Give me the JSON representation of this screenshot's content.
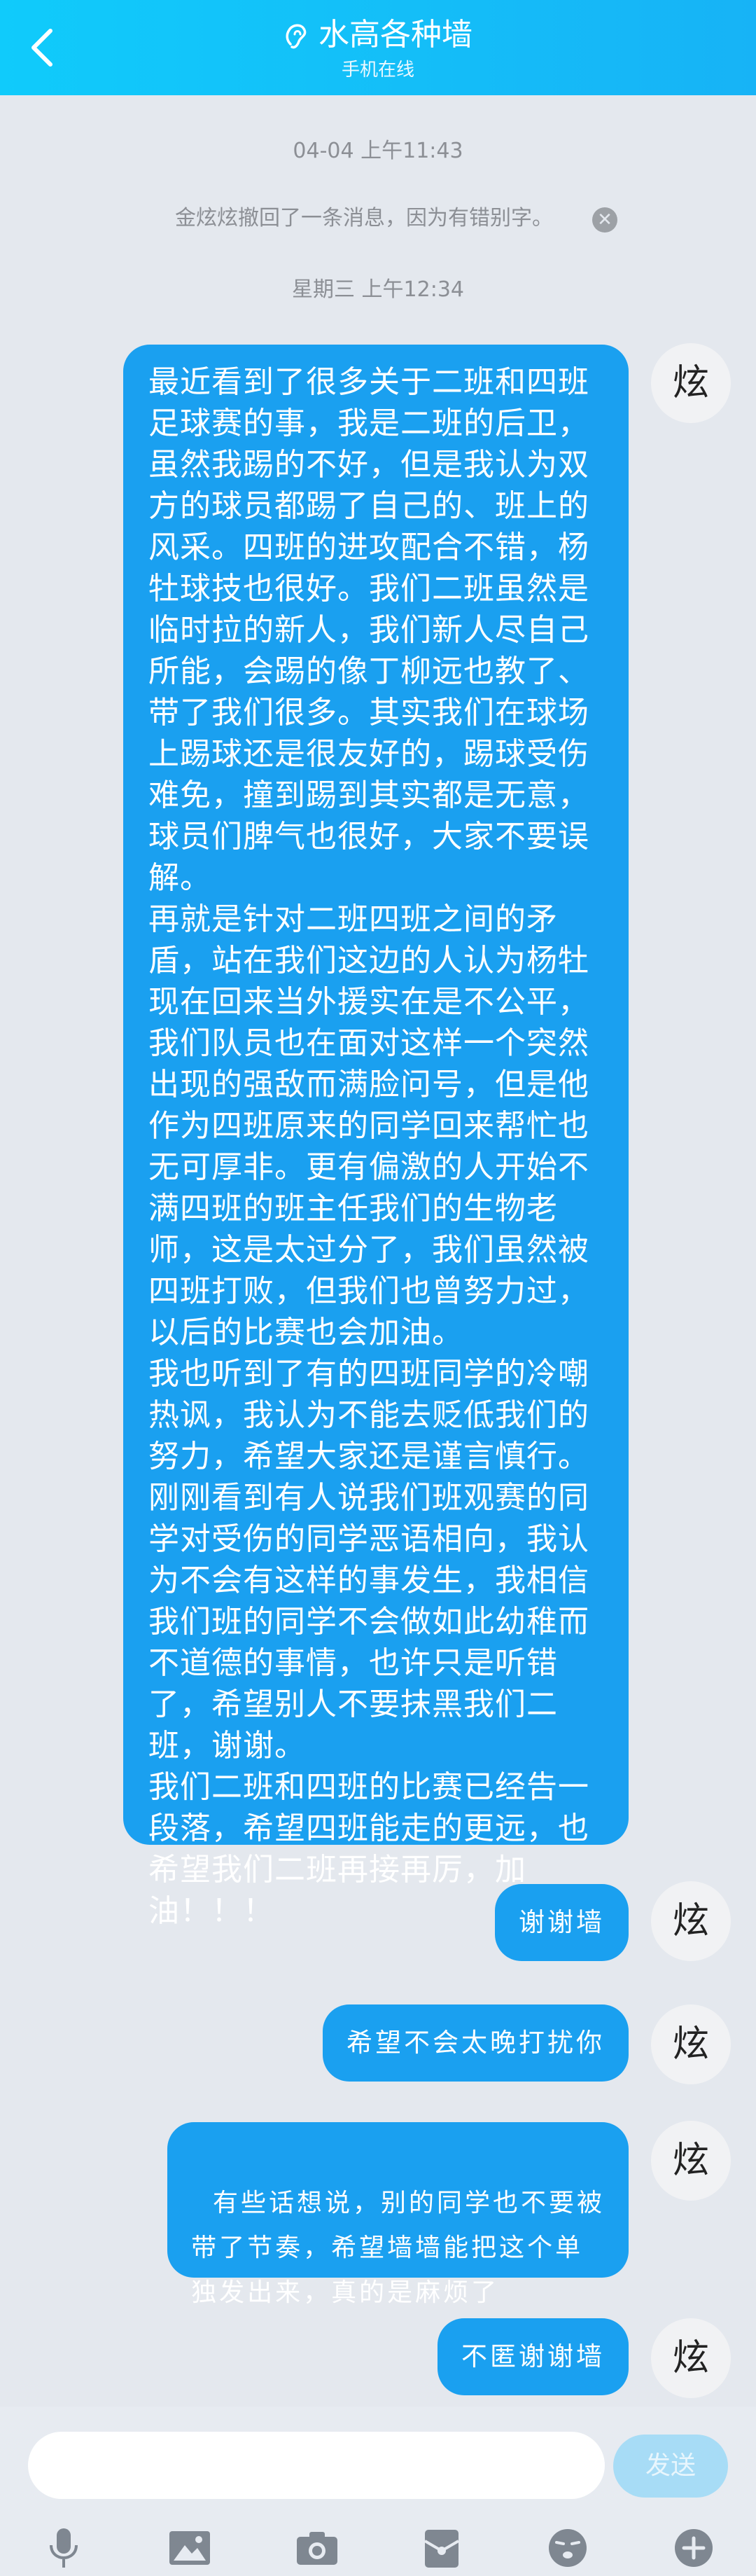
{
  "header": {
    "title": "水高各种墙",
    "subtitle": "手机在线",
    "color_start": "#10cbfb",
    "color_end": "#17b3f6"
  },
  "messages": {
    "timestamp_1": "04-04 上午11:43",
    "recall_notice": "金炫炫撤回了一条消息，因为有错别字。",
    "timestamp_2": "星期三 上午12:34",
    "avatar_char": "炫",
    "long_message": "最近看到了很多关于二班和四班足球赛的事，我是二班的后卫，虽然我踢的不好，但是我认为双方的球员都踢了自己的、班上的风采。四班的进攻配合不错，杨牡球技也很好。我们二班虽然是临时拉的新人，我们新人尽自己所能，会踢的像丁柳远也教了、带了我们很多。其实我们在球场上踢球还是很友好的，踢球受伤难免，撞到踢到其实都是无意，球员们脾气也很好，大家不要误解。\n再就是针对二班四班之间的矛盾，站在我们这边的人认为杨牡现在回来当外援实在是不公平，我们队员也在面对这样一个突然出现的强敌而满脸问号，但是他作为四班原来的同学回来帮忙也无可厚非。更有偏激的人开始不满四班的班主任我们的生物老师，这是太过分了，我们虽然被四班打败，但我们也曾努力过，以后的比赛也会加油。\n我也听到了有的四班同学的冷嘲热讽，我认为不能去贬低我们的努力，希望大家还是谨言慎行。刚刚看到有人说我们班观赛的同学对受伤的同学恶语相向，我认为不会有这样的事发生，我相信我们班的同学不会做如此幼稚而不道德的事情，也许只是听错了，希望别人不要抹黑我们二班，谢谢。\n我们二班和四班的比赛已经告一段落，希望四班能走的更远，也希望我们二班再接再厉，加油！！！",
    "msg_thanks": "谢谢墙",
    "msg_late": "希望不会太晚打扰你",
    "msg_request": "有些话想说，别的同学也不要被\n带了节奏，希望墙墙能把这个单\n独发出来，真的是麻烦了",
    "msg_thanks_2": "不匿谢谢墙",
    "bubble_color": "#1aa0f0"
  },
  "composer": {
    "input_value": "",
    "input_placeholder": "",
    "send_label": "发送"
  },
  "toolbar": {
    "icons": [
      "microphone-icon",
      "image-icon",
      "camera-icon",
      "red-packet-icon",
      "emoji-icon",
      "plus-icon"
    ]
  }
}
